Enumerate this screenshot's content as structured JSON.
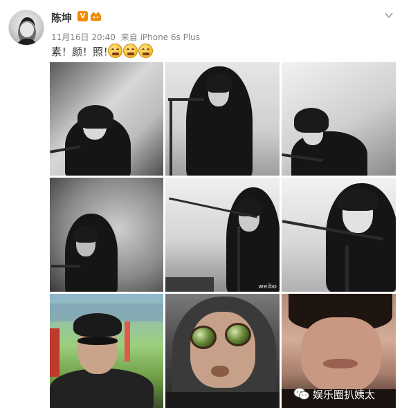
{
  "post": {
    "author": "陈坤",
    "vip_badge": "V",
    "meta": {
      "date": "11月16日 20:40",
      "source": "来自 iPhone 6s Plus"
    },
    "status_text": "素！颜！照！",
    "emoji_count": 3,
    "photos_count": 9,
    "photo_watermark": "weibo",
    "image_watermark": "娱乐圈扒姨太"
  },
  "colors": {
    "vip_badge": "#f08a00",
    "meta_text": "#808080",
    "name_text": "#333333"
  },
  "icons": {
    "avatar": "avatar",
    "vip": "vip-badge-icon",
    "crown": "crown-icon",
    "caret": "chevron-down-icon",
    "emoji": "laughing-emoji-icon",
    "wechat": "wechat-icon"
  }
}
